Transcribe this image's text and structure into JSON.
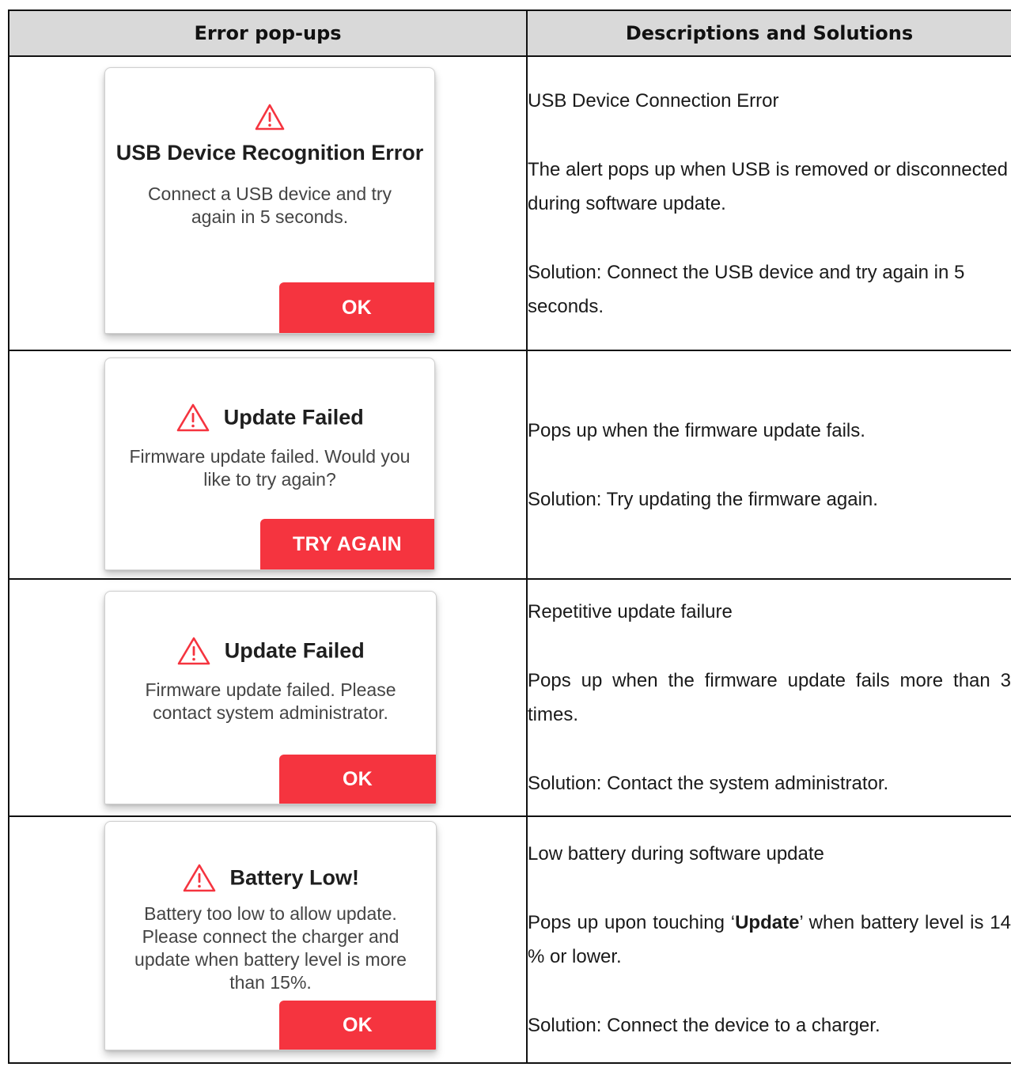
{
  "headers": {
    "popups": "Error pop-ups",
    "descriptions": "Descriptions and Solutions"
  },
  "accent_color": "#f5343f",
  "rows": [
    {
      "dialog": {
        "title": "USB Device Recognition Error",
        "message": "Connect a USB device and try again in 5 seconds.",
        "button": "OK",
        "icon": "warning-triangle-icon"
      },
      "heading": "USB Device Connection Error",
      "description": "The alert pops up when USB is removed or disconnected during software update.",
      "solution": "Solution: Connect the USB device and try again in 5 seconds."
    },
    {
      "dialog": {
        "title": "Update Failed",
        "message": "Firmware update failed. Would you like to try again?",
        "button": "TRY AGAIN",
        "icon": "warning-triangle-icon"
      },
      "description": "Pops up when the firmware update fails.",
      "solution": "Solution: Try updating the firmware again."
    },
    {
      "dialog": {
        "title": "Update Failed",
        "message": "Firmware update failed. Please contact system administrator.",
        "button": "OK",
        "icon": "warning-triangle-icon"
      },
      "heading": "Repetitive update failure",
      "description": "Pops up when the firmware update fails more than 3 times.",
      "solution": "Solution: Contact the system administrator."
    },
    {
      "dialog": {
        "title": "Battery Low!",
        "message": "Battery too low to allow update. Please connect the charger and update when battery level is more than 15%.",
        "button": "OK",
        "icon": "warning-triangle-icon"
      },
      "heading": "Low battery during software update",
      "description_pre": "Pops up upon touching ‘",
      "description_bold": "Update",
      "description_post": "’ when battery level is 14 % or lower.",
      "solution": "Solution: Connect the device to a charger."
    }
  ]
}
